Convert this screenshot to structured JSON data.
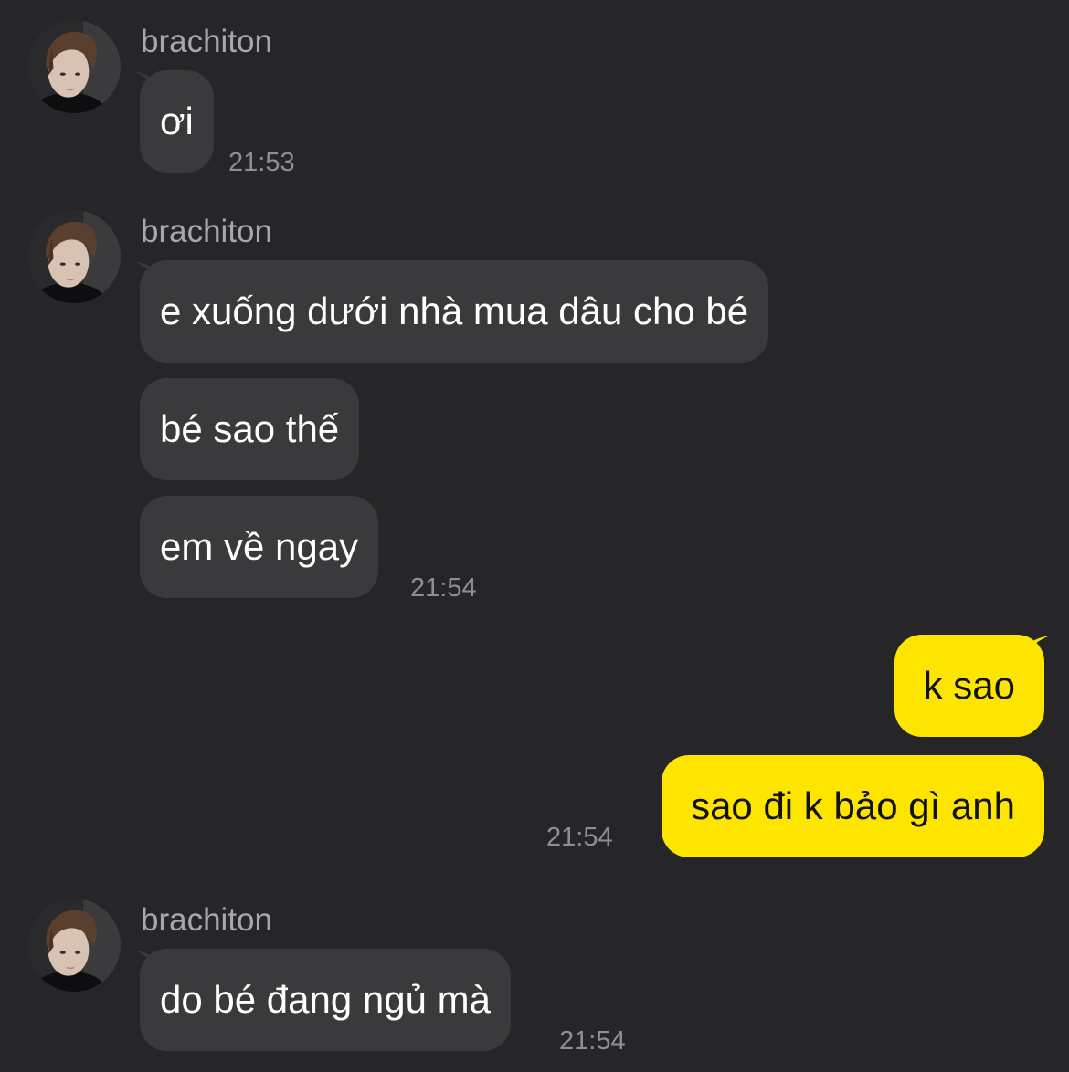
{
  "conversation": {
    "group1": {
      "sender": "brachiton",
      "messages": [
        "ơi"
      ],
      "time": "21:53"
    },
    "group2": {
      "sender": "brachiton",
      "messages": [
        "e xuống dưới nhà mua dâu cho bé",
        "bé sao thế",
        "em về ngay"
      ],
      "time": "21:54"
    },
    "group3": {
      "messages": [
        "k sao",
        "sao đi k bảo gì anh"
      ],
      "time": "21:54"
    },
    "group4": {
      "sender": "brachiton",
      "messages": [
        "do bé đang ngủ mà"
      ],
      "time": "21:54"
    }
  },
  "colors": {
    "background": "#262628",
    "incoming_bubble": "#3a3a3c",
    "outgoing_bubble": "#fee500",
    "sender_name": "#a8a8ab",
    "timestamp": "#8e8e93"
  },
  "icons": {
    "avatar": "profile-photo"
  }
}
